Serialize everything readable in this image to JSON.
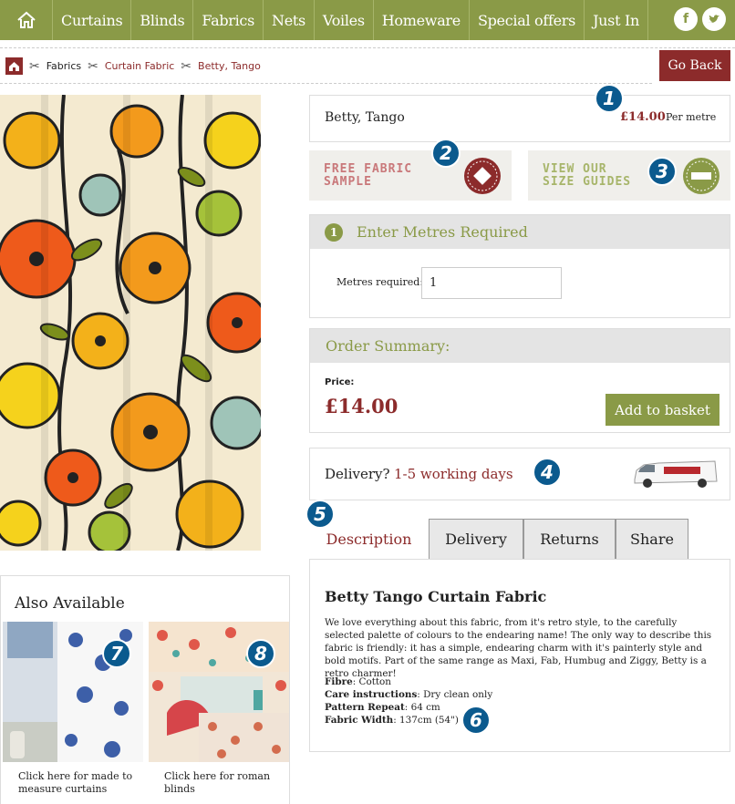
{
  "nav": {
    "items": [
      "Curtains",
      "Blinds",
      "Fabrics",
      "Nets",
      "Voiles",
      "Homeware",
      "Special offers",
      "Just In"
    ],
    "social": [
      "f",
      "t"
    ]
  },
  "breadcrumb": {
    "items": [
      "Fabrics",
      "Curtain Fabric",
      "Betty, Tango"
    ]
  },
  "go_back": "Go Back",
  "product": {
    "name": "Betty, Tango",
    "price": "£14.00",
    "per": "Per metre"
  },
  "promos": {
    "sample": [
      "FREE FABRIC",
      "SAMPLE"
    ],
    "sizes": [
      "VIEW OUR",
      "SIZE GUIDES"
    ]
  },
  "metres": {
    "step": "1",
    "heading": "Enter Metres Required",
    "label": "Metres required:",
    "value": "1"
  },
  "order": {
    "heading": "Order Summary:",
    "price_label": "Price:",
    "price_value": "£14.00",
    "add_button": "Add to basket"
  },
  "delivery": {
    "label": "Delivery?",
    "value": "1-5 working days"
  },
  "tabs": [
    "Description",
    "Delivery",
    "Returns",
    "Share"
  ],
  "description": {
    "title": "Betty Tango Curtain Fabric",
    "text": "We love everything about this fabric, from it's retro style, to the carefully selected palette of colours to the endearing name! The only way to describe this fabric is friendly: it has a simple, endearing charm with it's painterly style and bold motifs. Part of the same range as Maxi, Fab, Humbug and Ziggy, Betty is a retro charmer!",
    "specs": [
      {
        "label": "Fibre",
        "value": ": Cotton"
      },
      {
        "label": "Care instructions",
        "value": ": Dry clean only"
      },
      {
        "label": "Pattern Repeat",
        "value": ": 64 cm"
      },
      {
        "label": "Fabric Width",
        "value": ": 137cm (54\")"
      }
    ]
  },
  "also": {
    "heading": "Also Available",
    "items": [
      {
        "caption": "Click here for made to measure curtains"
      },
      {
        "caption": "Click here for roman blinds"
      }
    ]
  },
  "badges": [
    "1",
    "2",
    "3",
    "4",
    "5",
    "6",
    "7",
    "8"
  ],
  "colors": {
    "nav_green": "#8a9a47",
    "maroon": "#8c2b2b",
    "badge_blue": "#0b5a8e"
  }
}
